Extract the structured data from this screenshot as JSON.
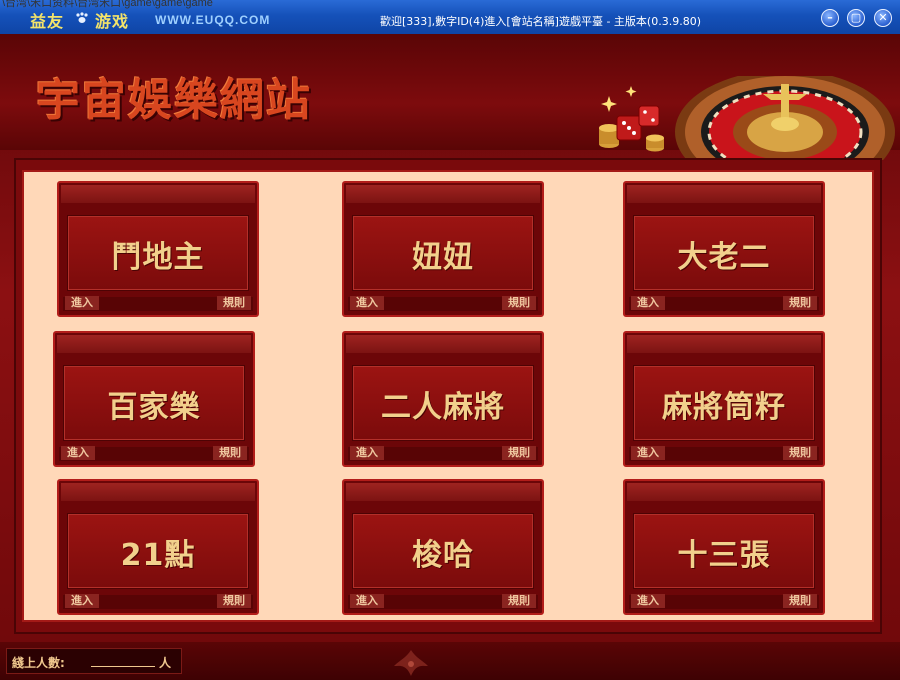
{
  "background_path": "\\台湾\\宋口资料\\台湾宋口\\game\\game\\game",
  "titlebar": {
    "logo_left": "益友",
    "logo_right": "游戏",
    "site": "WWW.EUQQ.COM",
    "title": "歡迎[333],數字ID(4)進入[會站名稱]遊戲平臺 - 主版本(0.3.9.80)",
    "buttons": {
      "minimize": "–",
      "maximize": "▢",
      "close": "✕"
    }
  },
  "brand": "宇宙娛樂網站",
  "games": [
    {
      "name": "鬥地主",
      "enter": "進入",
      "rules": "規則"
    },
    {
      "name": "妞妞",
      "enter": "進入",
      "rules": "規則"
    },
    {
      "name": "大老二",
      "enter": "進入",
      "rules": "規則"
    },
    {
      "name": "百家樂",
      "enter": "進入",
      "rules": "規則"
    },
    {
      "name": "二人麻將",
      "enter": "進入",
      "rules": "規則"
    },
    {
      "name": "麻將筒籽",
      "enter": "進入",
      "rules": "規則"
    },
    {
      "name": "21點",
      "enter": "進入",
      "rules": "規則"
    },
    {
      "name": "梭哈",
      "enter": "進入",
      "rules": "規則"
    },
    {
      "name": "十三張",
      "enter": "進入",
      "rules": "規則"
    }
  ],
  "footer": {
    "online_label": "綫上人數:",
    "online_unit": "人"
  },
  "colors": {
    "titlebar": "#1551b9",
    "frame": "#7a0a0c",
    "panel": "#ffd8b8",
    "card_text": "#f2d08c",
    "brand": "#d8461f"
  },
  "icons": [
    "paw-icon",
    "minimize-icon",
    "maximize-icon",
    "close-icon",
    "roulette-wheel-icon",
    "dice-icon",
    "coins-icon",
    "ornament-icon"
  ]
}
